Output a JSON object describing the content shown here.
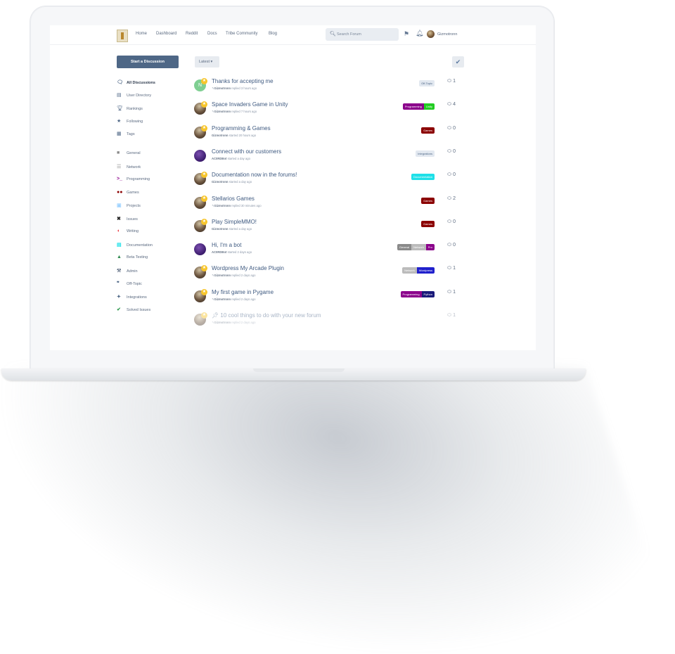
{
  "nav": {
    "items": [
      "Home",
      "Dashboard",
      "Reddit",
      "Docs",
      "Tribe Community",
      "Blog"
    ]
  },
  "search": {
    "placeholder": "Search Forum"
  },
  "user": {
    "name": "Gizmotronn"
  },
  "sidebar": {
    "start_button": "Start a Discussion",
    "links": [
      {
        "icon": "chat-bubbles-icon",
        "label": "All Discussions",
        "active": true
      },
      {
        "icon": "user-directory-icon",
        "label": "User Directory"
      },
      {
        "icon": "trophy-icon",
        "label": "Rankings"
      },
      {
        "icon": "star-icon",
        "label": "Following"
      },
      {
        "icon": "tags-grid-icon",
        "label": "Tags"
      }
    ],
    "tags": [
      {
        "icon": "square-icon",
        "label": "General",
        "color": "#8a8a8a"
      },
      {
        "icon": "list-icon",
        "label": "Network",
        "color": "#bbbbbb"
      },
      {
        "icon": "terminal-icon",
        "label": "Programming",
        "color": "#8b008b"
      },
      {
        "icon": "gamepad-icon",
        "label": "Games",
        "color": "#8b0000"
      },
      {
        "icon": "project-icon",
        "label": "Projects",
        "color": "#9fd3ff"
      },
      {
        "icon": "bug-icon",
        "label": "Issues",
        "color": "#222222"
      },
      {
        "icon": "writing-icon",
        "label": "Writing",
        "color": "#e8303a"
      },
      {
        "icon": "documentation-icon",
        "label": "Documentation",
        "color": "#1fe0e8"
      },
      {
        "icon": "flask-icon",
        "label": "Beta Testing",
        "color": "#2f8a4f"
      },
      {
        "icon": "wrench-icon",
        "label": "Admin",
        "color": "#5b6a80"
      },
      {
        "icon": "quote-icon",
        "label": "Off-Topic",
        "color": "#4e6786"
      },
      {
        "icon": "integration-icon",
        "label": "Integrations",
        "color": "#4e6786"
      },
      {
        "icon": "checkmark-icon",
        "label": "Solved Issues",
        "color": "#2f9a4f"
      }
    ]
  },
  "toolbar": {
    "sort_label": "Latest ▾"
  },
  "discussions": [
    {
      "title": "Thanks for accepting me",
      "meta_user": "Gizmotronn",
      "meta_text": "replied 3 hours ago",
      "reply_icon": true,
      "avatar": "green",
      "avatar_letter": "N",
      "tags": [
        {
          "label": "Off-Topic",
          "color": "#e2e8f0",
          "text": "#4e6786"
        }
      ],
      "replies": "1"
    },
    {
      "title": "Space Invaders Game in Unity",
      "meta_user": "Gizmotronn",
      "meta_text": "replied 7 hours ago",
      "reply_icon": true,
      "avatar": "m",
      "tags": [
        {
          "label": "Programming",
          "color": "#8b008b",
          "text": "#ffffff"
        },
        {
          "label": "Unity",
          "color": "#22cc22",
          "text": "#ffffff"
        }
      ],
      "replies": "4"
    },
    {
      "title": "Programming & Games",
      "meta_user": "Gizmotronn",
      "meta_text": "started 20 hours ago",
      "reply_icon": false,
      "avatar": "m",
      "tags": [
        {
          "label": "Games",
          "color": "#8b0000",
          "text": "#ffffff"
        }
      ],
      "replies": "0"
    },
    {
      "title": "Connect with our customers",
      "meta_user": "AC0RDBot",
      "meta_text": "started a day ago",
      "reply_icon": false,
      "avatar": "bot",
      "tags": [
        {
          "label": "Integrations",
          "color": "#e2e8f0",
          "text": "#4e6786"
        }
      ],
      "replies": "0"
    },
    {
      "title": "Documentation now in the forums!",
      "meta_user": "Gizmotronn",
      "meta_text": "started a day ago",
      "reply_icon": false,
      "avatar": "m",
      "tags": [
        {
          "label": "Documentation",
          "color": "#1fe0e8",
          "text": "#ffffff"
        }
      ],
      "replies": "0"
    },
    {
      "title": "Stellarios Games",
      "meta_user": "Gizmotronn",
      "meta_text": "replied 30 minutes ago",
      "reply_icon": true,
      "avatar": "m",
      "tags": [
        {
          "label": "Games",
          "color": "#8b0000",
          "text": "#ffffff"
        }
      ],
      "replies": "2"
    },
    {
      "title": "Play SimpleMMO!",
      "meta_user": "Gizmotronn",
      "meta_text": "started a day ago",
      "reply_icon": false,
      "avatar": "m",
      "tags": [
        {
          "label": "Games",
          "color": "#8b0000",
          "text": "#ffffff"
        }
      ],
      "replies": "0"
    },
    {
      "title": "Hi, I'm a bot",
      "meta_user": "AC0RDBot",
      "meta_text": "started 2 days ago",
      "reply_icon": false,
      "avatar": "bot",
      "tags": [
        {
          "label": "General",
          "color": "#8a8a8a",
          "text": "#ffffff"
        },
        {
          "label": "Network",
          "color": "#bbbbbb",
          "text": "#ffffff"
        },
        {
          "label": "Pro",
          "color": "#8b008b",
          "text": "#ffffff"
        }
      ],
      "replies": "0"
    },
    {
      "title": "Wordpress My Arcade Plugin",
      "meta_user": "Gizmotronn",
      "meta_text": "replied 2 days ago",
      "reply_icon": true,
      "avatar": "m",
      "tags": [
        {
          "label": "Network",
          "color": "#bbbbbb",
          "text": "#ffffff"
        },
        {
          "label": "Wordpress",
          "color": "#2020cc",
          "text": "#ffffff"
        }
      ],
      "replies": "1"
    },
    {
      "title": "My first game in Pygame",
      "meta_user": "Gizmotronn",
      "meta_text": "replied 2 days ago",
      "reply_icon": true,
      "avatar": "m",
      "tags": [
        {
          "label": "Programming",
          "color": "#8b008b",
          "text": "#ffffff"
        },
        {
          "label": "Python",
          "color": "#1a1a7a",
          "text": "#ffffff"
        }
      ],
      "replies": "1"
    },
    {
      "title": "10 cool things to do with your new forum",
      "meta_user": "Gizmotronn",
      "meta_text": "replied 2 days ago",
      "reply_icon": true,
      "avatar": "m",
      "pinned": true,
      "faded": true,
      "tags": [],
      "replies": "1"
    }
  ]
}
